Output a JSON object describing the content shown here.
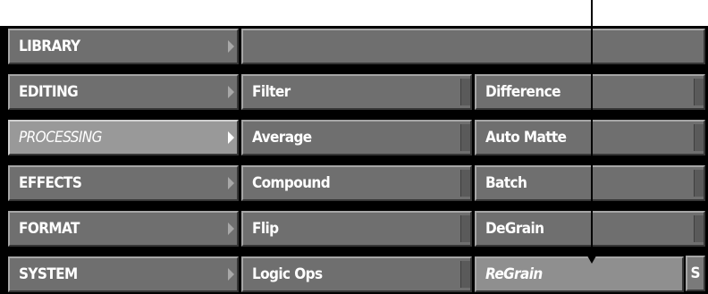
{
  "menu": {
    "categories": [
      {
        "label": "LIBRARY",
        "active": false
      },
      {
        "label": "EDITING",
        "active": false
      },
      {
        "label": "PROCESSING",
        "active": true
      },
      {
        "label": "EFFECTS",
        "active": false
      },
      {
        "label": "FORMAT",
        "active": false
      },
      {
        "label": "SYSTEM",
        "active": false
      }
    ],
    "column2": [
      "Filter",
      "Average",
      "Compound",
      "Flip",
      "Logic Ops"
    ],
    "column3": [
      "Difference",
      "Auto Matte",
      "Batch",
      "DeGrain",
      "ReGrain"
    ],
    "selected_item": "ReGrain",
    "s_button_label": "S"
  },
  "colors": {
    "button_face": "#6f6f6f",
    "active_button_face": "#999999",
    "background": "#000000",
    "text": "#ffffff"
  }
}
